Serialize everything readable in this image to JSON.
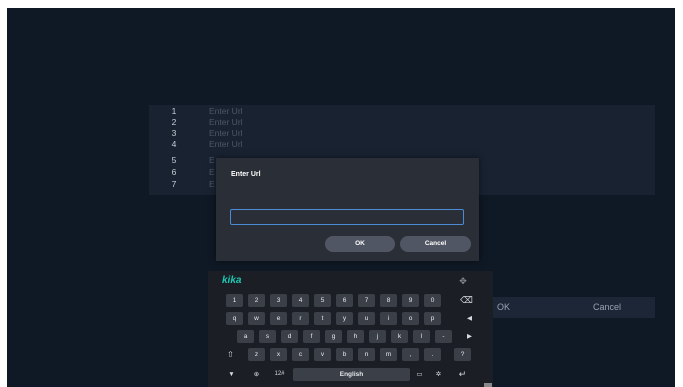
{
  "list": {
    "rows": [
      {
        "num": "1",
        "text": "Enter Url"
      },
      {
        "num": "2",
        "text": "Enter Url"
      },
      {
        "num": "3",
        "text": "Enter Url"
      },
      {
        "num": "4",
        "text": "Enter Url"
      },
      {
        "num": "5",
        "text": "E"
      },
      {
        "num": "6",
        "text": "E"
      },
      {
        "num": "7",
        "text": "E"
      }
    ]
  },
  "background_buttons": {
    "ok": "OK",
    "cancel": "Cancel"
  },
  "dialog": {
    "title": "Enter Url",
    "input_value": "",
    "ok": "OK",
    "cancel": "Cancel"
  },
  "keyboard": {
    "brand": "kika",
    "row1": [
      "1",
      "2",
      "3",
      "4",
      "5",
      "6",
      "7",
      "8",
      "9",
      "0"
    ],
    "row2": [
      "q",
      "w",
      "e",
      "r",
      "t",
      "y",
      "u",
      "i",
      "o",
      "p"
    ],
    "row3": [
      "a",
      "s",
      "d",
      "f",
      "g",
      "h",
      "j",
      "k",
      "l",
      "-"
    ],
    "row4": [
      "z",
      "x",
      "c",
      "v",
      "b",
      "n",
      "m",
      ",",
      ".",
      "?"
    ],
    "symbols": "12#",
    "space": "English"
  }
}
